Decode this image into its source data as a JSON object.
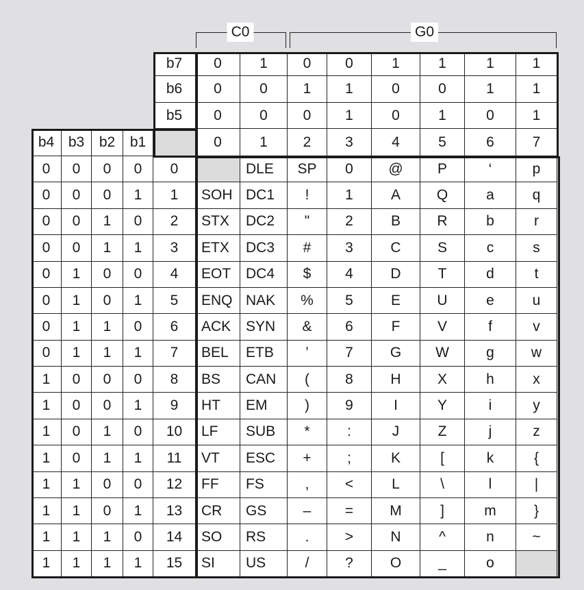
{
  "groups": [
    {
      "label": "C0"
    },
    {
      "label": "G0"
    }
  ],
  "bit_labels": {
    "b7": "b7",
    "b6": "b6",
    "b5": "b5",
    "b4": "b4",
    "b3": "b3",
    "b2": "b2",
    "b1": "b1"
  },
  "columns": [
    {
      "b7": "0",
      "b6": "0",
      "b5": "0",
      "num": "0"
    },
    {
      "b7": "1",
      "b6": "0",
      "b5": "0",
      "num": "1"
    },
    {
      "b7": "0",
      "b6": "1",
      "b5": "0",
      "num": "2"
    },
    {
      "b7": "0",
      "b6": "1",
      "b5": "1",
      "num": "3"
    },
    {
      "b7": "1",
      "b6": "0",
      "b5": "0",
      "num": "4"
    },
    {
      "b7": "1",
      "b6": "0",
      "b5": "1",
      "num": "5"
    },
    {
      "b7": "1",
      "b6": "1",
      "b5": "0",
      "num": "6"
    },
    {
      "b7": "1",
      "b6": "1",
      "b5": "1",
      "num": "7"
    }
  ],
  "rows": [
    {
      "bits": [
        "0",
        "0",
        "0",
        "0"
      ],
      "num": "0",
      "chars": [
        "",
        "DLE",
        "SP",
        "0",
        "@",
        "P",
        "‘",
        "p"
      ]
    },
    {
      "bits": [
        "0",
        "0",
        "0",
        "1"
      ],
      "num": "1",
      "chars": [
        "SOH",
        "DC1",
        "!",
        "1",
        "A",
        "Q",
        "a",
        "q"
      ]
    },
    {
      "bits": [
        "0",
        "0",
        "1",
        "0"
      ],
      "num": "2",
      "chars": [
        "STX",
        "DC2",
        "\"",
        "2",
        "B",
        "R",
        "b",
        "r"
      ]
    },
    {
      "bits": [
        "0",
        "0",
        "1",
        "1"
      ],
      "num": "3",
      "chars": [
        "ETX",
        "DC3",
        "#",
        "3",
        "C",
        "S",
        "c",
        "s"
      ]
    },
    {
      "bits": [
        "0",
        "1",
        "0",
        "0"
      ],
      "num": "4",
      "chars": [
        "EOT",
        "DC4",
        "$",
        "4",
        "D",
        "T",
        "d",
        "t"
      ]
    },
    {
      "bits": [
        "0",
        "1",
        "0",
        "1"
      ],
      "num": "5",
      "chars": [
        "ENQ",
        "NAK",
        "%",
        "5",
        "E",
        "U",
        "e",
        "u"
      ]
    },
    {
      "bits": [
        "0",
        "1",
        "1",
        "0"
      ],
      "num": "6",
      "chars": [
        "ACK",
        "SYN",
        "&",
        "6",
        "F",
        "V",
        "f",
        "v"
      ]
    },
    {
      "bits": [
        "0",
        "1",
        "1",
        "1"
      ],
      "num": "7",
      "chars": [
        "BEL",
        "ETB",
        "’",
        "7",
        "G",
        "W",
        "g",
        "w"
      ]
    },
    {
      "bits": [
        "1",
        "0",
        "0",
        "0"
      ],
      "num": "8",
      "chars": [
        "BS",
        "CAN",
        "(",
        "8",
        "H",
        "X",
        "h",
        "x"
      ]
    },
    {
      "bits": [
        "1",
        "0",
        "0",
        "1"
      ],
      "num": "9",
      "chars": [
        "HT",
        "EM",
        ")",
        "9",
        "I",
        "Y",
        "i",
        "y"
      ]
    },
    {
      "bits": [
        "1",
        "0",
        "1",
        "0"
      ],
      "num": "10",
      "chars": [
        "LF",
        "SUB",
        "*",
        ":",
        "J",
        "Z",
        "j",
        "z"
      ]
    },
    {
      "bits": [
        "1",
        "0",
        "1",
        "1"
      ],
      "num": "11",
      "chars": [
        "VT",
        "ESC",
        "+",
        ";",
        "K",
        "[",
        "k",
        "{"
      ]
    },
    {
      "bits": [
        "1",
        "1",
        "0",
        "0"
      ],
      "num": "12",
      "chars": [
        "FF",
        "FS",
        ",",
        "<",
        "L",
        "\\",
        "l",
        "|"
      ]
    },
    {
      "bits": [
        "1",
        "1",
        "0",
        "1"
      ],
      "num": "13",
      "chars": [
        "CR",
        "GS",
        "–",
        "=",
        "M",
        "]",
        "m",
        "}"
      ]
    },
    {
      "bits": [
        "1",
        "1",
        "1",
        "0"
      ],
      "num": "14",
      "chars": [
        "SO",
        "RS",
        ".",
        ">",
        "N",
        "^",
        "n",
        "~"
      ]
    },
    {
      "bits": [
        "1",
        "1",
        "1",
        "1"
      ],
      "num": "15",
      "chars": [
        "SI",
        "US",
        "/",
        "?",
        "O",
        "_",
        "o",
        ""
      ]
    }
  ]
}
